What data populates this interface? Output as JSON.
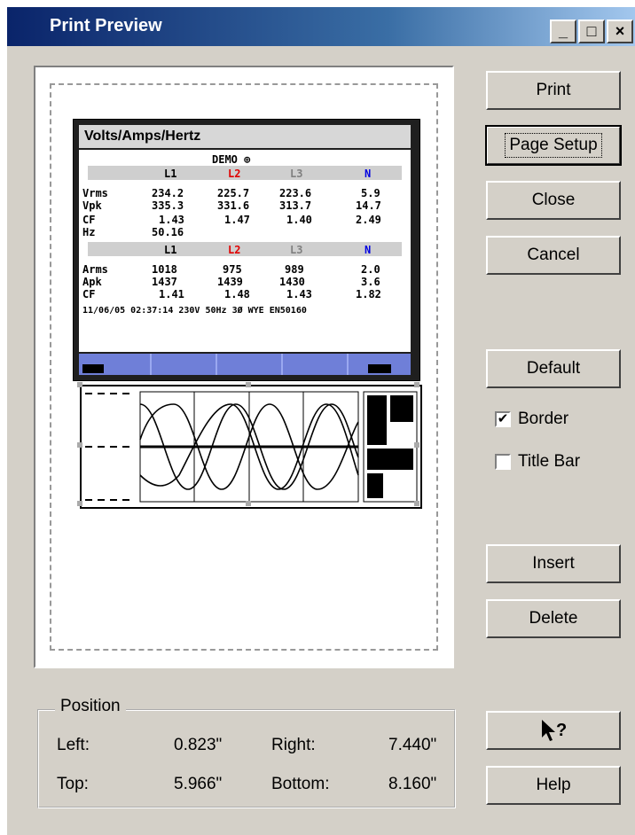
{
  "window": {
    "title": "Print Preview"
  },
  "titlebar_buttons": {
    "minimize": "_",
    "maximize": "□",
    "close": "×"
  },
  "buttons": {
    "print": "Print",
    "page_setup": "Page Setup",
    "close": "Close",
    "cancel": "Cancel",
    "default": "Default",
    "insert": "Insert",
    "delete": "Delete",
    "help": "Help"
  },
  "checkboxes": {
    "border": {
      "label": "Border",
      "checked": true
    },
    "title_bar": {
      "label": "Title Bar",
      "checked": false
    }
  },
  "position": {
    "label": "Position",
    "left_label": "Left:",
    "left_value": "0.823\"",
    "right_label": "Right:",
    "right_value": "7.440\"",
    "top_label": "Top:",
    "top_value": "5.966\"",
    "bottom_label": "Bottom:",
    "bottom_value": "8.160\""
  },
  "preview_screen": {
    "title": "Volts/Amps/Hertz",
    "subtitle": "DEMO ⊕",
    "phases": [
      "L1",
      "L2",
      "L3",
      "N"
    ],
    "phase_colors": [
      "#000000",
      "#e00000",
      "#808080",
      "#0000e0"
    ],
    "volts": [
      {
        "label": "Vrms",
        "values": [
          "234.2",
          "225.7",
          "223.6",
          "5.9"
        ]
      },
      {
        "label": "Vpk",
        "values": [
          "335.3",
          "331.6",
          "313.7",
          "14.7"
        ]
      },
      {
        "label": "CF",
        "values": [
          "1.43",
          "1.47",
          "1.40",
          "2.49"
        ]
      },
      {
        "label": "Hz",
        "values": [
          "50.16",
          "",
          "",
          ""
        ]
      }
    ],
    "amps": [
      {
        "label": "Arms",
        "values": [
          "1018",
          "975",
          "989",
          "2.0"
        ]
      },
      {
        "label": "Apk",
        "values": [
          "1437",
          "1439",
          "1430",
          "3.6"
        ]
      },
      {
        "label": "CF",
        "values": [
          "1.41",
          "1.48",
          "1.43",
          "1.82"
        ]
      }
    ],
    "status_line": "11/06/05 02:37:14   230V 50Hz 3Ø WYE   EN50160"
  },
  "icons": {
    "help_cursor": "whats-this-help-cursor-icon",
    "checkmark": "✔"
  }
}
